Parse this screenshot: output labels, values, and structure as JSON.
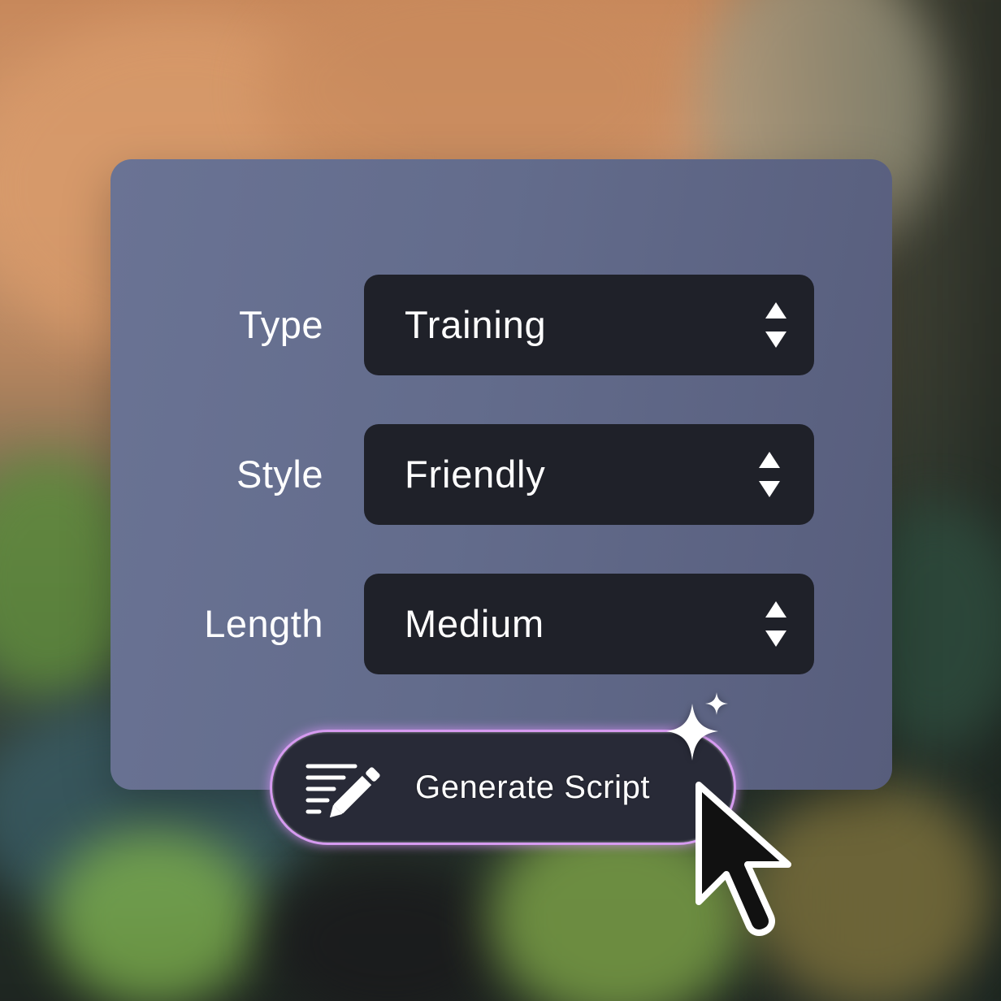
{
  "form": {
    "rows": [
      {
        "label": "Type",
        "value": "Training"
      },
      {
        "label": "Style",
        "value": "Friendly"
      },
      {
        "label": "Length",
        "value": "Medium"
      }
    ]
  },
  "action": {
    "label": "Generate Script"
  },
  "icons": {
    "select_indicator": "up-down-chevron-icon",
    "button_icon": "script-pencil-icon",
    "sparkle": "sparkle-icon",
    "cursor": "mouse-pointer-icon"
  },
  "colors": {
    "card": "#636c8c",
    "select_background": "#1f2129",
    "button_background": "#282a37",
    "button_glow": "#d69bf0",
    "text": "#ffffff"
  }
}
